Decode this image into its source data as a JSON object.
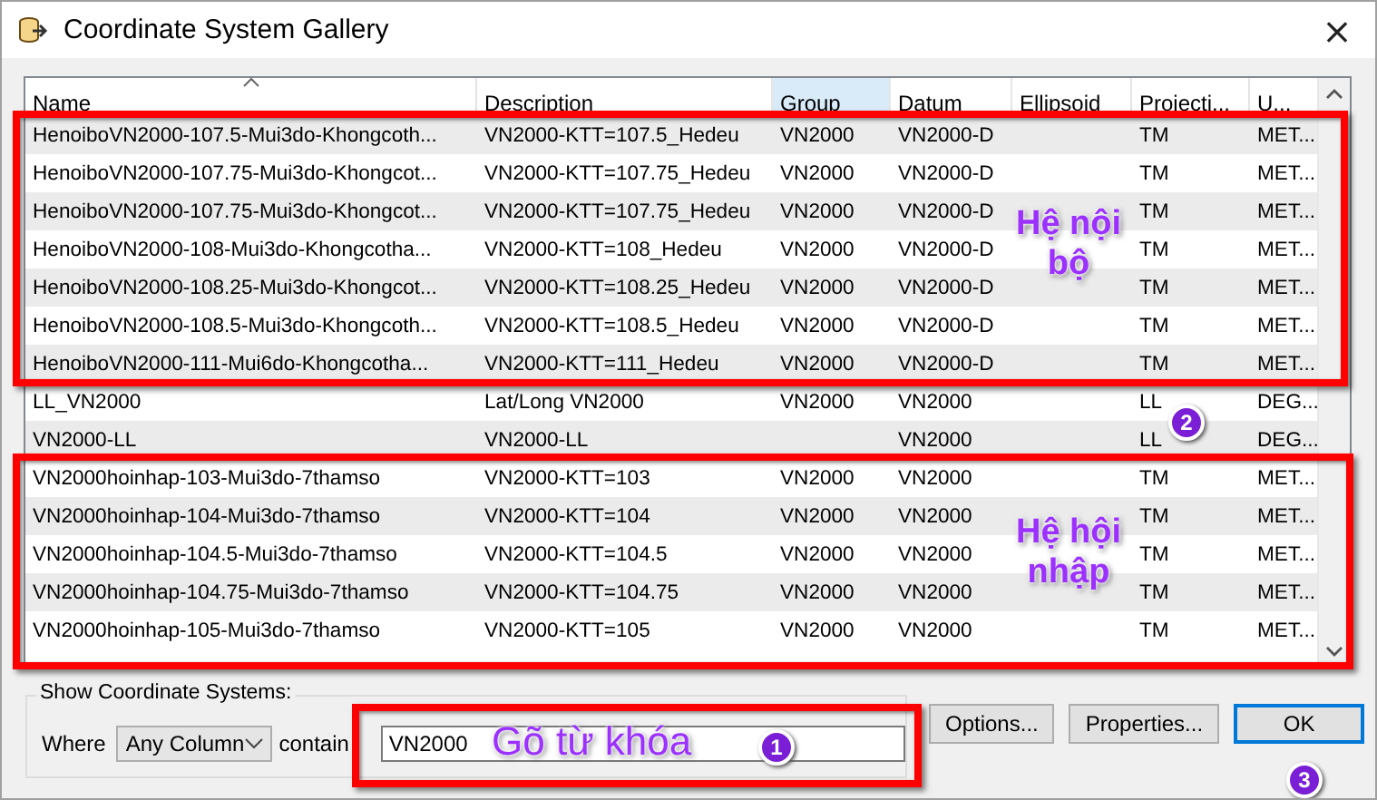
{
  "window": {
    "title": "Coordinate System Gallery",
    "close": "×"
  },
  "table": {
    "columns": [
      {
        "label": "Name",
        "sorted": true,
        "highlighted": false
      },
      {
        "label": "Description",
        "sorted": false,
        "highlighted": false
      },
      {
        "label": "Group",
        "sorted": false,
        "highlighted": true
      },
      {
        "label": "Datum",
        "sorted": false,
        "highlighted": false
      },
      {
        "label": "Ellipsoid",
        "sorted": false,
        "highlighted": false
      },
      {
        "label": "Projecti...",
        "sorted": false,
        "highlighted": false
      },
      {
        "label": "U...",
        "sorted": false,
        "highlighted": false
      }
    ],
    "rows": [
      [
        "HenoiboVN2000-107.5-Mui3do-Khongcoth...",
        "VN2000-KTT=107.5_Hedeu",
        "VN2000",
        "VN2000-D",
        "",
        "TM",
        "MET..."
      ],
      [
        "HenoiboVN2000-107.75-Mui3do-Khongcot...",
        "VN2000-KTT=107.75_Hedeu",
        "VN2000",
        "VN2000-D",
        "",
        "TM",
        "MET..."
      ],
      [
        "HenoiboVN2000-107.75-Mui3do-Khongcot...",
        "VN2000-KTT=107.75_Hedeu",
        "VN2000",
        "VN2000-D",
        "",
        "TM",
        "MET..."
      ],
      [
        "HenoiboVN2000-108-Mui3do-Khongcotha...",
        "VN2000-KTT=108_Hedeu",
        "VN2000",
        "VN2000-D",
        "",
        "TM",
        "MET..."
      ],
      [
        "HenoiboVN2000-108.25-Mui3do-Khongcot...",
        "VN2000-KTT=108.25_Hedeu",
        "VN2000",
        "VN2000-D",
        "",
        "TM",
        "MET..."
      ],
      [
        "HenoiboVN2000-108.5-Mui3do-Khongcoth...",
        "VN2000-KTT=108.5_Hedeu",
        "VN2000",
        "VN2000-D",
        "",
        "TM",
        "MET..."
      ],
      [
        "HenoiboVN2000-111-Mui6do-Khongcotha...",
        "VN2000-KTT=111_Hedeu",
        "VN2000",
        "VN2000-D",
        "",
        "TM",
        "MET..."
      ],
      [
        "LL_VN2000",
        "Lat/Long VN2000",
        "VN2000",
        "VN2000",
        "",
        "LL",
        "DEG..."
      ],
      [
        "VN2000-LL",
        "VN2000-LL",
        "",
        "VN2000",
        "",
        "LL",
        "DEG..."
      ],
      [
        "VN2000hoinhap-103-Mui3do-7thamso",
        "VN2000-KTT=103",
        "VN2000",
        "VN2000",
        "",
        "TM",
        "MET..."
      ],
      [
        "VN2000hoinhap-104-Mui3do-7thamso",
        "VN2000-KTT=104",
        "VN2000",
        "VN2000",
        "",
        "TM",
        "MET..."
      ],
      [
        "VN2000hoinhap-104.5-Mui3do-7thamso",
        "VN2000-KTT=104.5",
        "VN2000",
        "VN2000",
        "",
        "TM",
        "MET..."
      ],
      [
        "VN2000hoinhap-104.75-Mui3do-7thamso",
        "VN2000-KTT=104.75",
        "VN2000",
        "VN2000",
        "",
        "TM",
        "MET..."
      ],
      [
        "VN2000hoinhap-105-Mui3do-7thamso",
        "VN2000-KTT=105",
        "VN2000",
        "VN2000",
        "",
        "TM",
        "MET..."
      ]
    ]
  },
  "filter": {
    "title": "Show Coordinate Systems:",
    "where_label": "Where",
    "column": "Any Column",
    "contains_label": "contain",
    "search": "VN2000"
  },
  "buttons": [
    {
      "label": "Options...",
      "default": false
    },
    {
      "label": "Properties...",
      "default": false
    },
    {
      "label": "OK",
      "default": true
    }
  ],
  "annotations": {
    "callouts": [
      {
        "text": "Hệ nội bộ",
        "kind": "title"
      },
      {
        "text": "Hệ hội nhập",
        "kind": "title"
      },
      {
        "text": "Gõ từ khóa",
        "kind": "hint"
      }
    ],
    "badges": [
      "1",
      "2",
      "3"
    ]
  }
}
